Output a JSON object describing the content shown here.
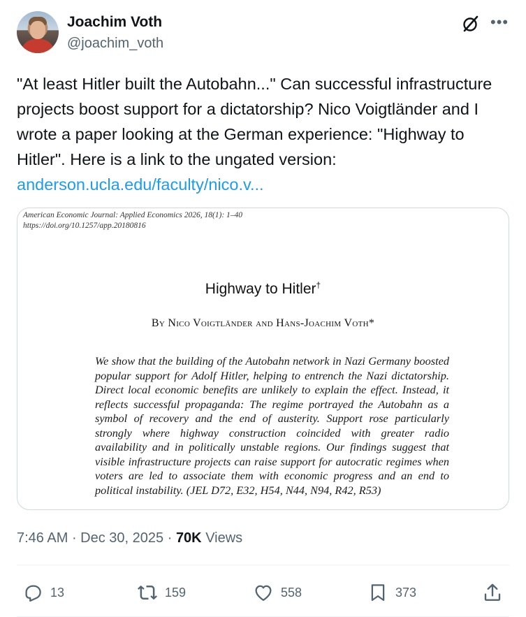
{
  "author": {
    "display_name": "Joachim Voth",
    "handle": "@joachim_voth"
  },
  "tweet": {
    "text": "\"At least Hitler built the Autobahn...\" Can successful infrastructure projects boost support for a dictatorship? Nico Voigtländer and I wrote a paper looking at the German experience: \"Highway to Hitler\". Here is a link to the ungated version: ",
    "link_text": "anderson.ucla.edu/faculty/nico.v..."
  },
  "paper": {
    "journal": "American Economic Journal: Applied Economics 2026, 18(1): 1–40",
    "doi": "https://doi.org/10.1257/app.20180816",
    "title": "Highway to Hitler",
    "title_mark": "†",
    "authors": "By Nico Voigtländer and Hans-Joachim Voth*",
    "abstract": "We show that the building of the Autobahn network in Nazi Germany boosted popular support for Adolf Hitler, helping to entrench the Nazi dictatorship. Direct local economic benefits are unlikely to explain the effect. Instead, it reflects successful propaganda: The regime portrayed the Autobahn as a symbol of recovery and the end of austerity. Support rose particularly strongly where highway construction coincided with greater radio availability and in politically unstable regions. Our findings suggest that visible infrastructure projects can raise support for autocratic regimes when voters are led to associate them with economic progress and an end to political instability. (JEL D72, E32, H54, N44, N94, R42, R53)"
  },
  "meta": {
    "time": "7:46 AM",
    "separator": " · ",
    "date": "Dec 30, 2025",
    "views_count": "70K",
    "views_label": " Views"
  },
  "actions": {
    "replies": "13",
    "reposts": "159",
    "likes": "558",
    "bookmarks": "373"
  },
  "icons": {
    "reply": "reply-icon",
    "repost": "repost-icon",
    "like": "heart-icon",
    "bookmark": "bookmark-icon",
    "share": "share-icon",
    "grok": "grok-icon",
    "more": "more-icon"
  },
  "colors": {
    "link": "#1d9bf0",
    "secondary_text": "#536471",
    "primary_text": "#0f1419"
  }
}
